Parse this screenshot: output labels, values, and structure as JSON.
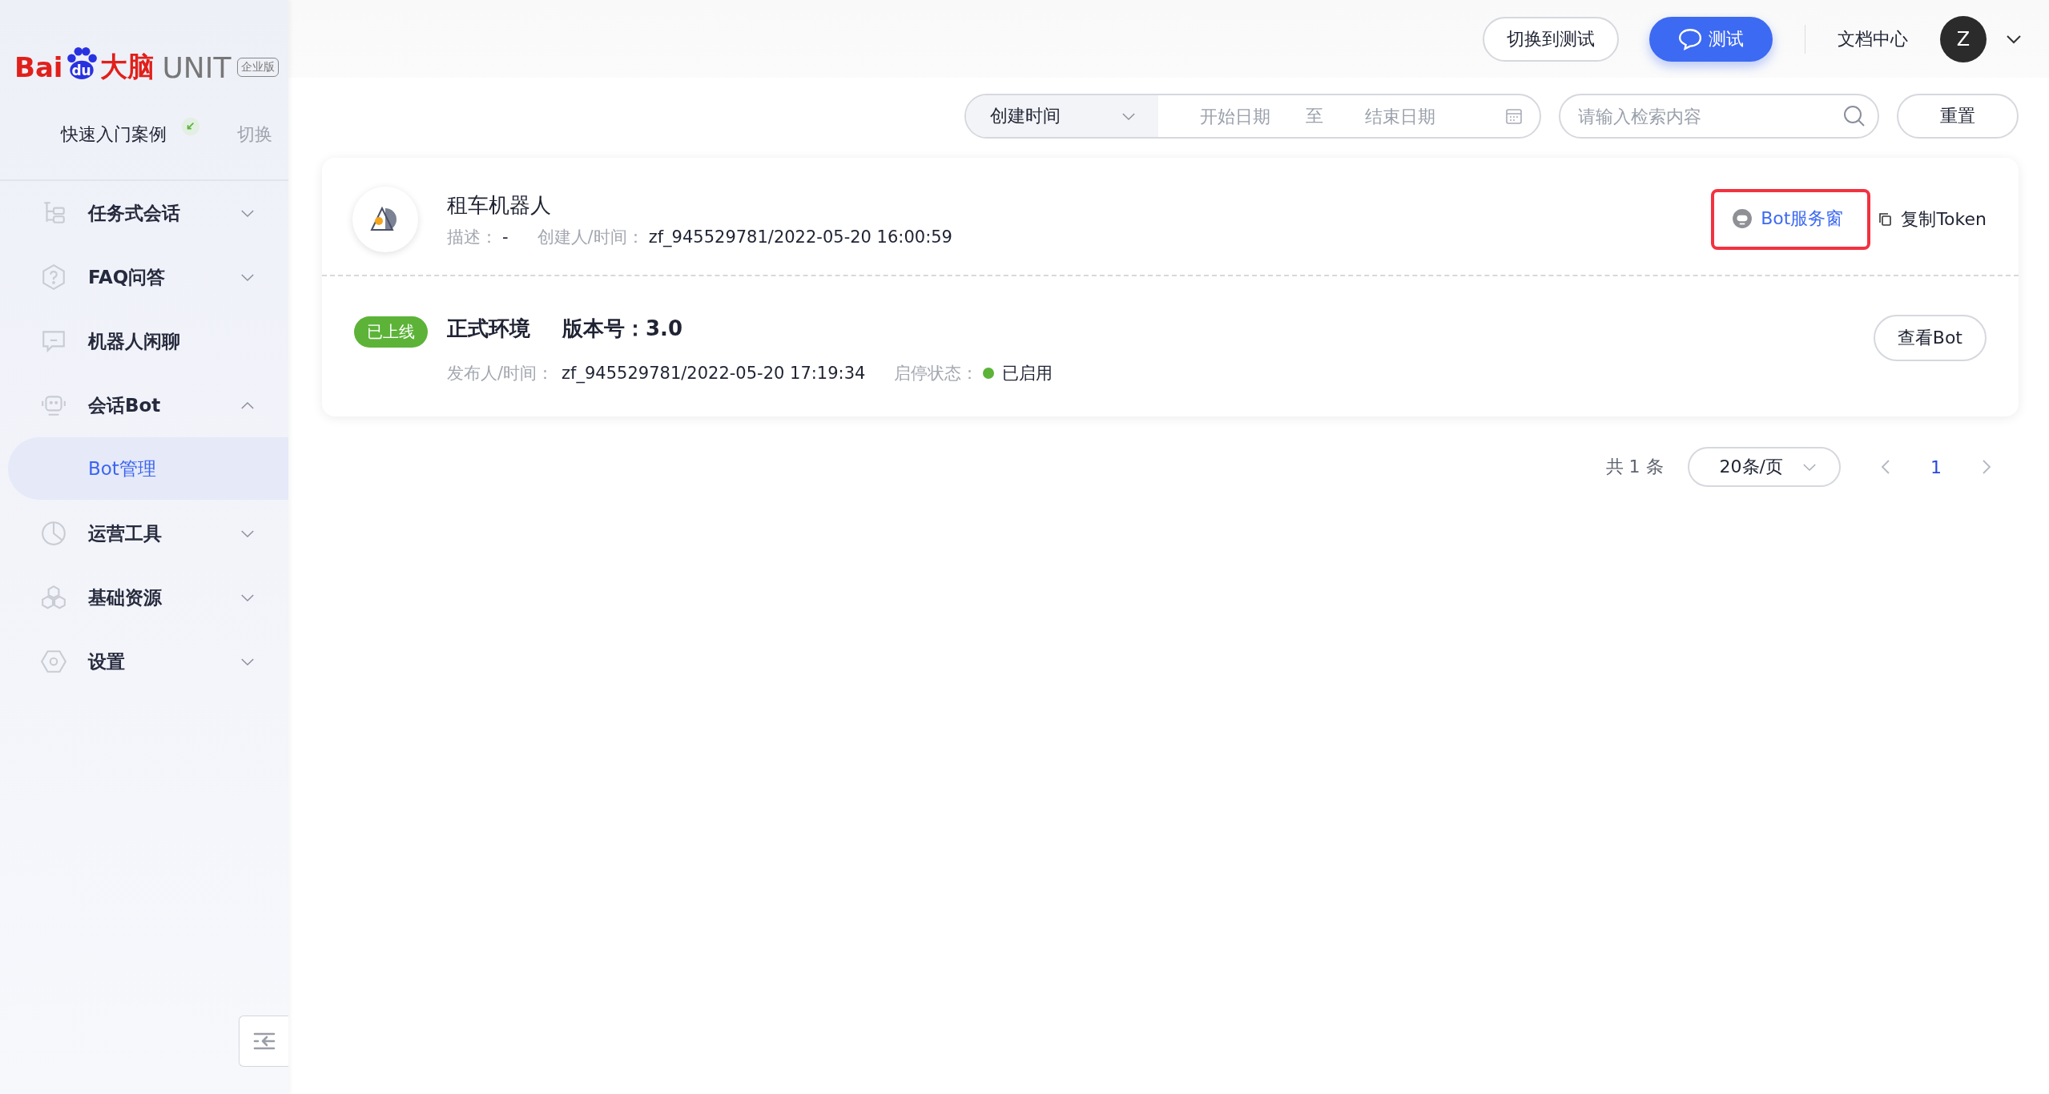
{
  "logo": {
    "brand_left": "Bai",
    "brand_paw": "du",
    "brand_right": "大脑",
    "product": "UNIT",
    "edition": "企业版"
  },
  "workspace": {
    "name": "快速入门案例",
    "switch": "切换"
  },
  "sidebar": {
    "items": [
      {
        "label": "任务式会话",
        "kind": "group",
        "expanded": false
      },
      {
        "label": "FAQ问答",
        "kind": "group",
        "expanded": false
      },
      {
        "label": "机器人闲聊",
        "kind": "link"
      },
      {
        "label": "会话Bot",
        "kind": "group",
        "expanded": true,
        "children": [
          {
            "label": "Bot管理",
            "selected": true
          }
        ]
      },
      {
        "label": "运营工具",
        "kind": "group",
        "expanded": false
      },
      {
        "label": "基础资源",
        "kind": "group",
        "expanded": false
      },
      {
        "label": "设置",
        "kind": "group",
        "expanded": false
      }
    ]
  },
  "topbar": {
    "switch_button": "切换到测试",
    "test_button": "测试",
    "docs_link": "文档中心",
    "avatar": "Z"
  },
  "filters": {
    "field_select": "创建时间",
    "start_placeholder": "开始日期",
    "range_separator": "至",
    "end_placeholder": "结束日期",
    "search_placeholder": "请输入检索内容",
    "reset_button": "重置"
  },
  "bot": {
    "name": "租车机器人",
    "desc_label": "描述：",
    "desc_value": "-",
    "creator_label": "创建人/时间：",
    "creator_value": "zf_945529781/2022-05-20 16:00:59",
    "service_link": "Bot服务窗",
    "service_highlighted": true,
    "copy_token": "复制Token",
    "release": {
      "badge": "已上线",
      "online": true,
      "env": "正式环境",
      "version_label": "版本号：",
      "version": "3.0",
      "publisher_label": "发布人/时间：",
      "publisher_value": "zf_945529781/2022-05-20 17:19:34",
      "state_label": "启停状态：",
      "state_value": "已启用",
      "enabled": true,
      "view_button": "查看Bot"
    }
  },
  "pagination": {
    "total": "共 1 条",
    "page_size": "20条/页",
    "pages": [
      {
        "label": "1",
        "selected": true
      }
    ]
  }
}
